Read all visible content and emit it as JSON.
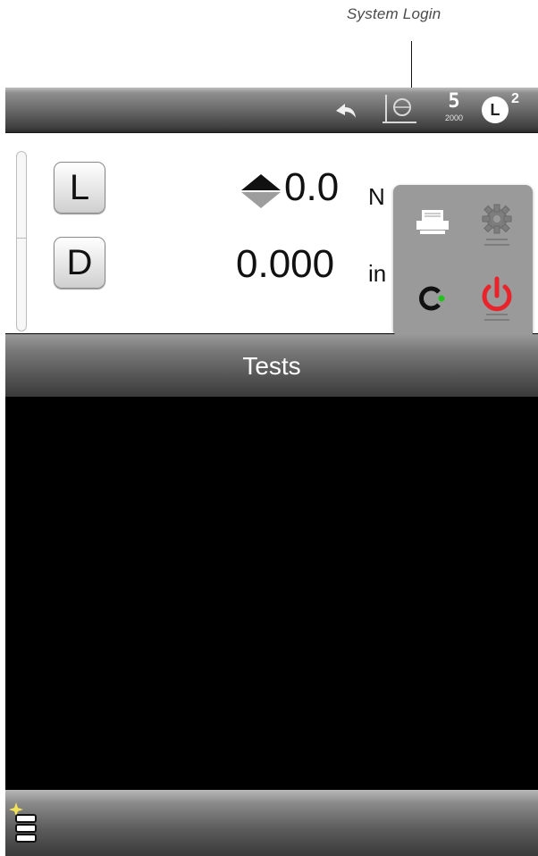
{
  "callout": {
    "label": "System Login"
  },
  "status_bar": {
    "undo_icon": "curved-arrow-icon",
    "frame_icon": "frame-crosshead-icon",
    "system_badge": {
      "number": "5",
      "model": "2000"
    },
    "load_cell_badge": {
      "letter": "L",
      "superscript": "2"
    }
  },
  "readout": {
    "load": {
      "key_label": "L",
      "value": "0.0",
      "unit": "N"
    },
    "displacement": {
      "key_label": "D",
      "value": "0.000",
      "unit": "in"
    }
  },
  "popup_menu": {
    "items": [
      {
        "name": "print",
        "icon": "printer-icon"
      },
      {
        "name": "settings",
        "icon": "gear-icon"
      },
      {
        "name": "system-login",
        "icon": "login-icon"
      },
      {
        "name": "power",
        "icon": "power-icon"
      }
    ]
  },
  "tests": {
    "title": "Tests"
  },
  "bottom_bar": {
    "new_test_icon": "list-add-icon"
  },
  "colors": {
    "power": "#e8232a",
    "login_dot": "#22c21d",
    "bar_dark": "#3a3a3a"
  }
}
